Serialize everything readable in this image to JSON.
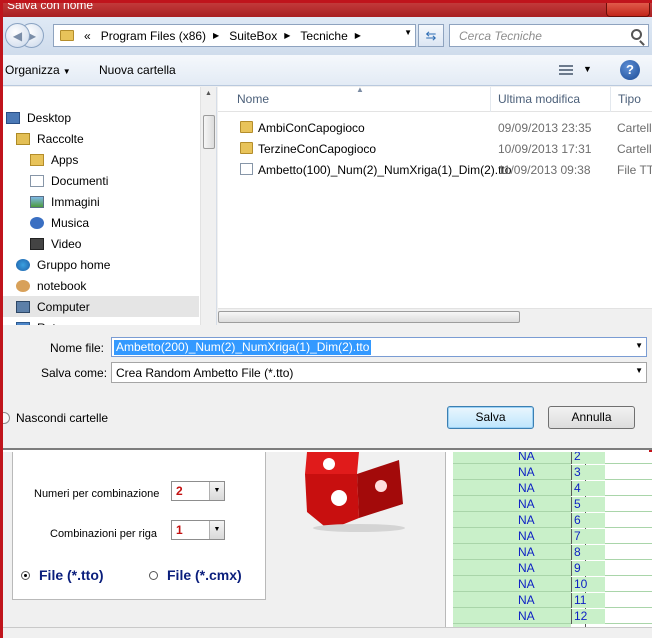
{
  "dialog": {
    "title": "Salva con nome",
    "address": {
      "overflow": "«",
      "crumbs": [
        "Program Files (x86)",
        "SuiteBox",
        "Tecniche"
      ]
    },
    "search_placeholder": "Cerca Tecniche",
    "toolbar": {
      "organize": "Organizza",
      "new_folder": "Nuova cartella"
    },
    "nav_items": [
      {
        "label": "Desktop",
        "icon": "desktop-icon",
        "selected": false
      },
      {
        "label": "Raccolte",
        "icon": "library-icon",
        "selected": false
      },
      {
        "label": "Apps",
        "icon": "folder-icon",
        "selected": false
      },
      {
        "label": "Documenti",
        "icon": "documents-icon",
        "selected": false
      },
      {
        "label": "Immagini",
        "icon": "pictures-icon",
        "selected": false
      },
      {
        "label": "Musica",
        "icon": "music-icon",
        "selected": false
      },
      {
        "label": "Video",
        "icon": "video-icon",
        "selected": false
      },
      {
        "label": "Gruppo home",
        "icon": "homegroup-icon",
        "selected": false
      },
      {
        "label": "notebook",
        "icon": "user-icon",
        "selected": false
      },
      {
        "label": "Computer",
        "icon": "computer-icon",
        "selected": true
      },
      {
        "label": "Rete",
        "icon": "network-icon",
        "selected": false
      }
    ],
    "columns": {
      "name": "Nome",
      "modified": "Ultima modifica",
      "type": "Tipo"
    },
    "files": [
      {
        "name": "AmbiConCapogioco",
        "date": "09/09/2013 23:35",
        "type": "Cartella di file",
        "kind": "folder"
      },
      {
        "name": "TerzineConCapogioco",
        "date": "10/09/2013 17:31",
        "type": "Cartella di file",
        "kind": "folder"
      },
      {
        "name": "Ambetto(100)_Num(2)_NumXriga(1)_Dim(2).tto",
        "date": "11/09/2013 09:38",
        "type": "File TTO",
        "kind": "file"
      }
    ],
    "filename_label": "Nome file:",
    "filename_value": "Ambetto(200)_Num(2)_NumXriga(1)_Dim(2).tto",
    "savetype_label": "Salva come:",
    "savetype_value": "Crea Random Ambetto File (*.tto)",
    "hide_folders": "Nascondi cartelle",
    "save_button": "Salva",
    "cancel_button": "Annulla"
  },
  "app": {
    "numbers_label": "Numeri per combinazione",
    "numbers_value": "2",
    "combos_label": "Combinazioni per riga",
    "combos_value": "1",
    "radio_tto": "File (*.tto)",
    "radio_cmx": "File (*.cmx)",
    "grid_rows": [
      {
        "na": "NA",
        "num": "2"
      },
      {
        "na": "NA",
        "num": "3"
      },
      {
        "na": "NA",
        "num": "4"
      },
      {
        "na": "NA",
        "num": "5"
      },
      {
        "na": "NA",
        "num": "6"
      },
      {
        "na": "NA",
        "num": "7"
      },
      {
        "na": "NA",
        "num": "8"
      },
      {
        "na": "NA",
        "num": "9"
      },
      {
        "na": "NA",
        "num": "10"
      },
      {
        "na": "NA",
        "num": "11"
      },
      {
        "na": "NA",
        "num": "12"
      }
    ]
  },
  "colors": {
    "frame_red": "#c0141c",
    "selection_blue": "#3399ff",
    "grid_green": "#c9f0c9",
    "grid_text_blue": "#0c1fc4",
    "radio_text_navy": "#0a1e7c"
  }
}
